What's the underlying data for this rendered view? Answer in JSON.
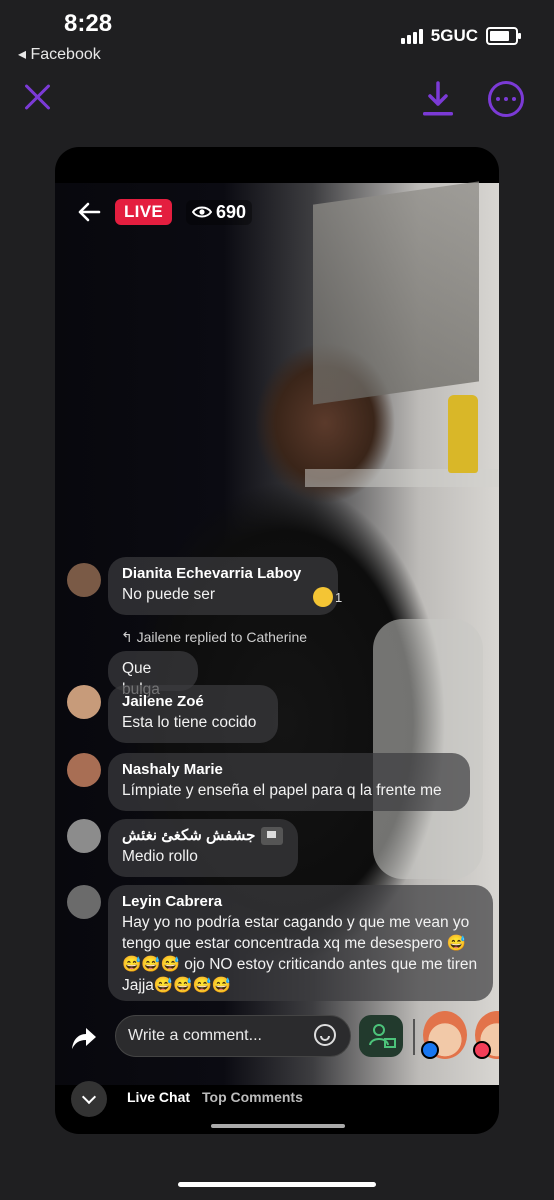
{
  "status": {
    "time": "8:28",
    "back_app": "◂ Facebook",
    "network": "5GUC",
    "battery_level": 0.85
  },
  "viewer": {
    "live_label": "LIVE",
    "view_count": "690"
  },
  "comments": [
    {
      "name": "Dianita Echevarria Laboy",
      "text": "No puede ser",
      "reaction_count": "1"
    },
    {
      "reply_context": "Jailene replied to Catherine",
      "text": "Que bulga"
    },
    {
      "name": "Jailene Zoé",
      "text": "Esta lo tiene cocido"
    },
    {
      "name": "Nashaly Marie",
      "text": "Límpiate y enseña el papel para q la frente me"
    },
    {
      "name": "جشفش شكغئ نغئش",
      "text": "Medio rollo"
    },
    {
      "name": "Leyin Cabrera",
      "text": "Hay yo no podría estar cagando y que me vean yo tengo que estar concentrada xq me desespero 😅😅😅😅 ojo NO estoy criticando antes que me tiren Jajja😅😅😅😅"
    }
  ],
  "composer": {
    "placeholder": "Write a comment..."
  },
  "tabs": {
    "live_chat": "Live Chat",
    "top_comments": "Top Comments"
  },
  "icons": [
    "close-icon",
    "download-icon",
    "more-icon",
    "back-arrow-icon",
    "eye-icon",
    "share-icon",
    "emoji-icon",
    "guest-icon",
    "chevron-down-icon"
  ],
  "colors": {
    "accent": "#7b3ad6",
    "live_red": "#e41e3f"
  }
}
